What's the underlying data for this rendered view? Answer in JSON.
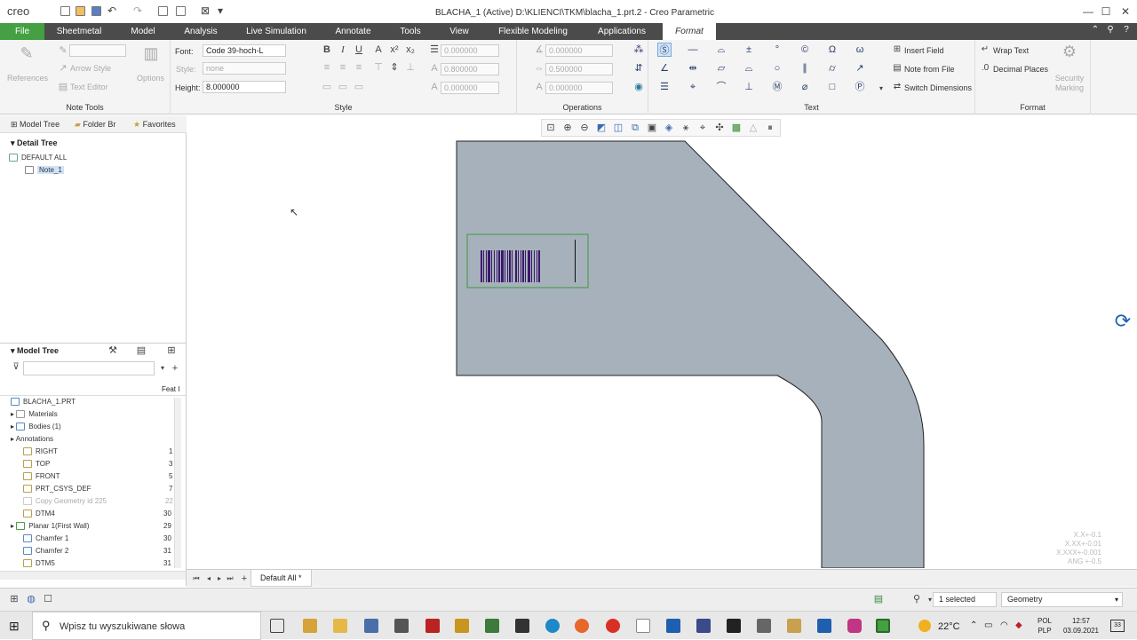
{
  "app": {
    "name": "creo",
    "window_title": "BLACHA_1 (Active) D:\\KLIENCI\\TKM\\blacha_1.prt.2 - Creo Parametric"
  },
  "tabs": [
    "File",
    "Sheetmetal",
    "Model",
    "Analysis",
    "Live Simulation",
    "Annotate",
    "Tools",
    "View",
    "Flexible Modeling",
    "Applications",
    "Format"
  ],
  "ribbon": {
    "note_tools": {
      "references": "References",
      "arrow_style": "Arrow Style",
      "text_editor": "Text Editor",
      "options": "Options",
      "label": "Note Tools"
    },
    "style": {
      "font_label": "Font:",
      "font_value": "Code 39-hoch-L",
      "style_label": "Style:",
      "style_value": "none",
      "height_label": "Height:",
      "height_value": "8.000000",
      "label": "Style"
    },
    "operations": {
      "v1": "0.000000",
      "v2": "0.800000",
      "v3": "0.000000",
      "v4": "0.000000",
      "v5": "0.500000",
      "v6": "0.000000",
      "label": "Operations"
    },
    "text": {
      "insert_field": "Insert Field",
      "note_from_file": "Note from File",
      "switch_dimensions": "Switch Dimensions",
      "label": "Text"
    },
    "format": {
      "wrap_text": "Wrap Text",
      "decimal_places": "Decimal Places",
      "security_marking": "Security Marking",
      "label": "Format"
    }
  },
  "nav_tabs": [
    "Model Tree",
    "Folder Br",
    "Favorites"
  ],
  "detail_tree": {
    "title": "Detail Tree",
    "items": [
      "DEFAULT ALL",
      "Note_1"
    ]
  },
  "model_tree": {
    "title": "Model Tree",
    "col_header": "Feat I",
    "items": [
      {
        "label": "BLACHA_1.PRT",
        "num": ""
      },
      {
        "label": "Materials",
        "num": ""
      },
      {
        "label": "Bodies (1)",
        "num": ""
      },
      {
        "label": "Annotations",
        "num": ""
      },
      {
        "label": "RIGHT",
        "num": "1"
      },
      {
        "label": "TOP",
        "num": "3"
      },
      {
        "label": "FRONT",
        "num": "5"
      },
      {
        "label": "PRT_CSYS_DEF",
        "num": "7"
      },
      {
        "label": "Copy Geometry id 225",
        "num": "22"
      },
      {
        "label": "DTM4",
        "num": "30"
      },
      {
        "label": "Planar 1(First Wall)",
        "num": "29"
      },
      {
        "label": "Chamfer 1",
        "num": "30"
      },
      {
        "label": "Chamfer 2",
        "num": "31"
      },
      {
        "label": "DTM5",
        "num": "31"
      }
    ]
  },
  "sheet_tab": "Default All *",
  "tolerance": [
    "X.X+-0.1",
    "X.XX+-0.01",
    "X.XXX+-0.001",
    "ANG +-0.5"
  ],
  "status": {
    "selected": "1 selected",
    "filter": "Geometry"
  },
  "taskbar": {
    "search": "Wpisz tu wyszukiwane słowa",
    "temp": "22°C",
    "lang1": "POL",
    "lang2": "PLP",
    "time": "12:57",
    "date": "03.09.2021",
    "notif": "33"
  }
}
